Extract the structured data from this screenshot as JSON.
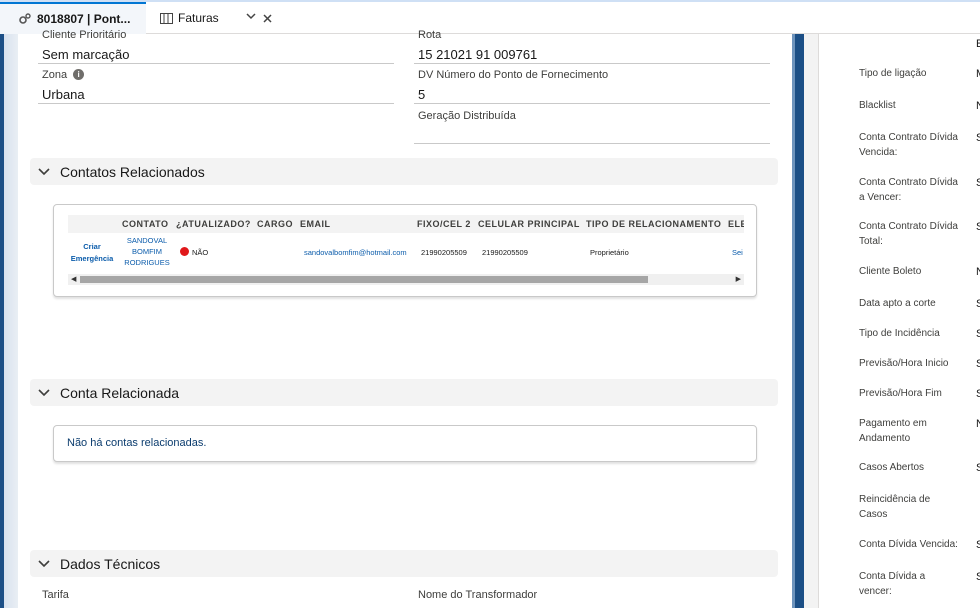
{
  "tabs": [
    {
      "label": "8018807 | Pont..."
    },
    {
      "label": "Faturas"
    }
  ],
  "fields_top": {
    "cliente_label": "Cliente Prioritário",
    "cliente_value": "Sem marcação",
    "rota_label": "Rota",
    "rota_value": "15 21021 91 009761",
    "zona_label": "Zona",
    "zona_value": "Urbana",
    "dv_label": "DV Número do Ponto de Fornecimento",
    "dv_value": "5",
    "geracao_label": "Geração Distribuída",
    "geracao_value": ""
  },
  "contatos": {
    "title": "Contatos Relacionados",
    "columns": [
      "CONTATO",
      "¿ATUALIZADO?",
      "CARGO",
      "EMAIL",
      "FIXO/CEL 2",
      "CELULAR PRINCIPAL",
      "TIPO DE RELACIONAMENTO",
      "ELE"
    ],
    "row": {
      "action": "Criar Emergência",
      "contato": "SANDOVAL BOMFIM RODRIGUES",
      "atualizado": "NÃO",
      "email": "sandovalbomfim@hotmail.com",
      "fixo": "21990205509",
      "celular": "21990205509",
      "tipo": "Proprietário",
      "ele": "Sei"
    }
  },
  "conta_relacionada": {
    "title": "Conta Relacionada",
    "empty": "Não há contas relacionadas."
  },
  "dados_tecnicos": {
    "title": "Dados Técnicos",
    "tarifa_label": "Tarifa",
    "transformador_label": "Nome do Transformador"
  },
  "right_panel": {
    "top_value": "E",
    "items": [
      {
        "label": "Tipo de ligação",
        "value": "M"
      },
      {
        "label": "Blacklist",
        "value": "N"
      },
      {
        "label": "Conta Contrato Dívida Vencida:",
        "value": "S"
      },
      {
        "label": "Conta Contrato Dívida a Vencer:",
        "value": "S"
      },
      {
        "label": "Conta Contrato Dívida Total:",
        "value": "S"
      },
      {
        "label": "Cliente Boleto",
        "value": "N"
      },
      {
        "label": "Data apto a corte",
        "value": "S"
      },
      {
        "label": "Tipo de Incidência",
        "value": "S"
      },
      {
        "label": "Previsão/Hora Inicio",
        "value": "S"
      },
      {
        "label": "Previsão/Hora Fim",
        "value": "S"
      },
      {
        "label": "Pagamento em Andamento",
        "value": "N"
      },
      {
        "label": "Casos Abertos",
        "value": "S"
      },
      {
        "label": "Reincidência de Casos",
        "value": ""
      },
      {
        "label": "Conta Dívida Vencida:",
        "value": "S"
      },
      {
        "label": "Conta Dívida a vencer:",
        "value": "S"
      }
    ]
  },
  "colors": {
    "accent": "#0176d3",
    "link": "#0b5cab",
    "status_no": "#e0181b"
  }
}
